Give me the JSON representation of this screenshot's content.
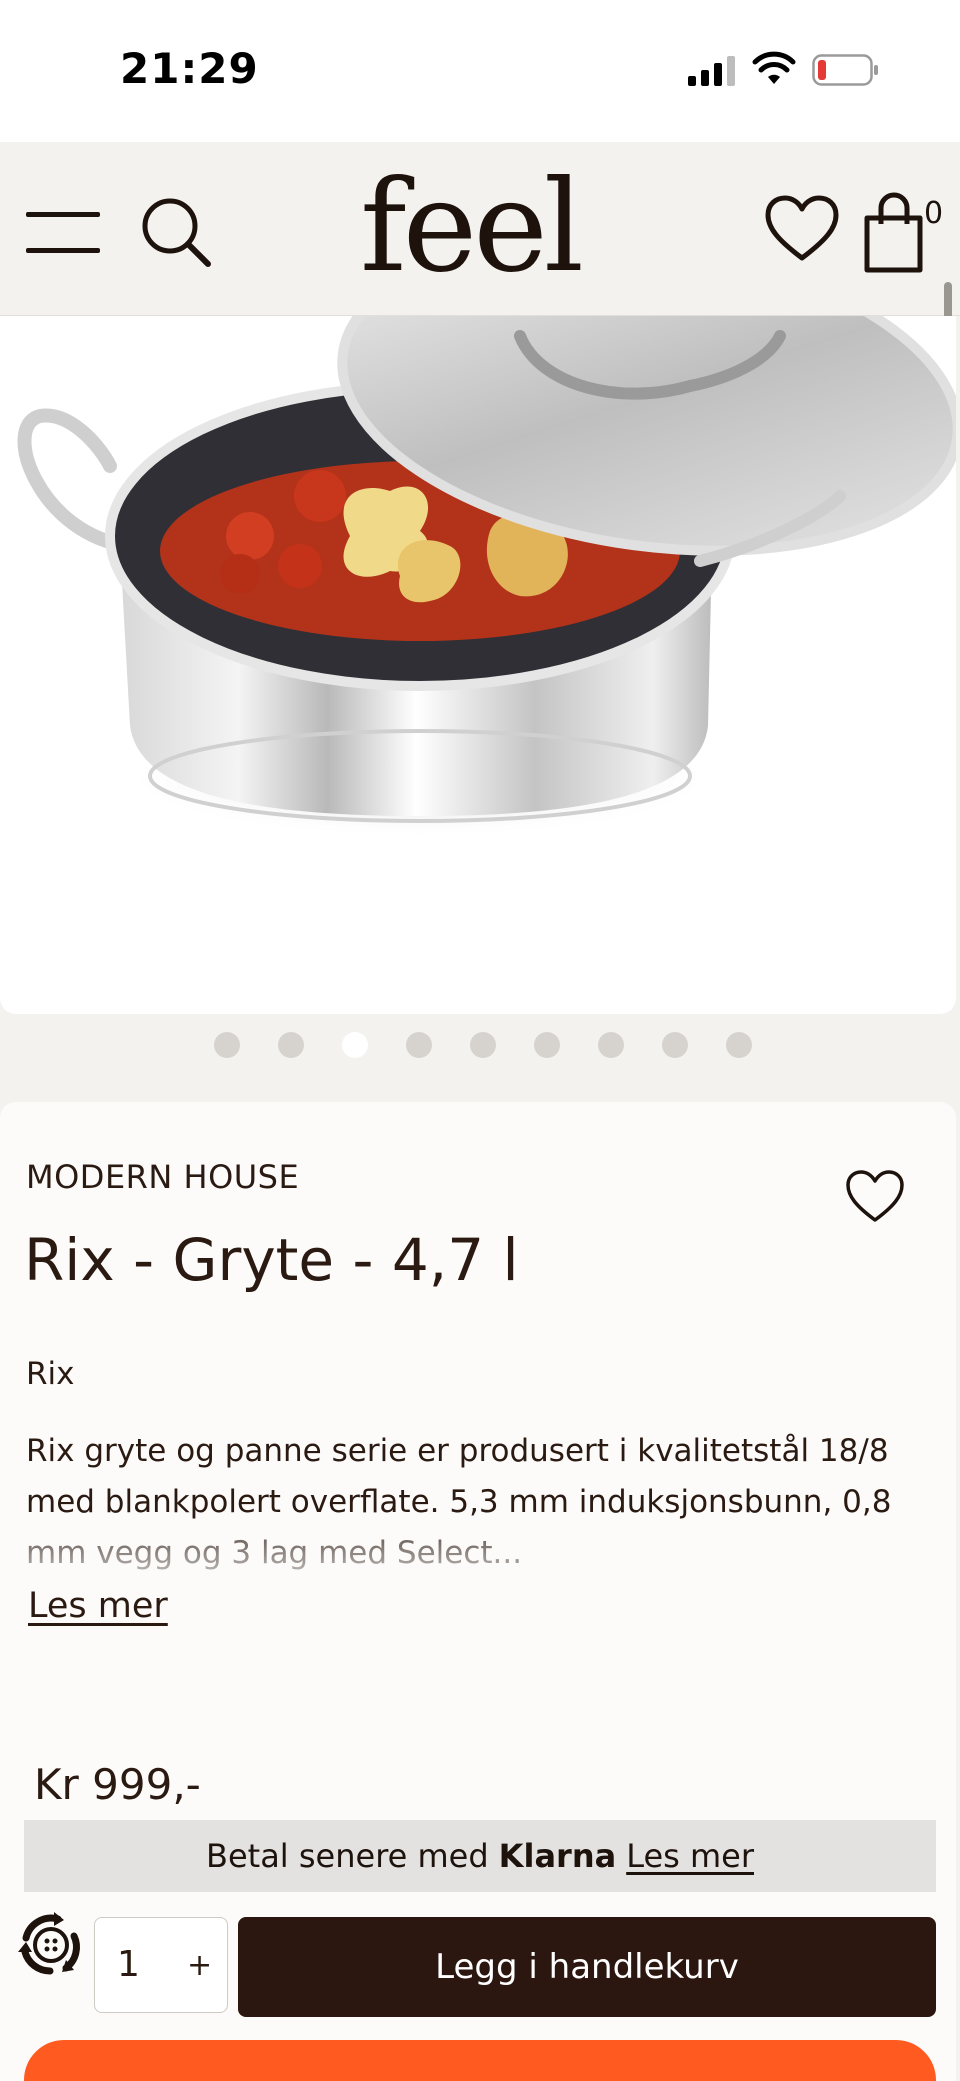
{
  "status_bar": {
    "time": "21:29"
  },
  "header": {
    "logo": "feel",
    "cart_count": "0"
  },
  "gallery": {
    "dot_count": 9,
    "active_index": 2
  },
  "product": {
    "brand": "MODERN HOUSE",
    "title": "Rix - Gryte - 4,7 l",
    "subtitle": "Rix",
    "description": "Rix gryte og panne serie er produsert i kvalitetstål 18/8 med blankpolert overflate. 5,3 mm induksjonsbunn, 0,8 mm vegg og 3 lag med Select...",
    "read_more": "Les mer",
    "price": "Kr 999,-"
  },
  "klarna": {
    "prefix": "Betal senere med",
    "brand": "Klarna",
    "link": "Les mer"
  },
  "purchase": {
    "quantity": "1",
    "plus": "+",
    "add_to_cart": "Legg i handlekurv"
  },
  "colors": {
    "header_bg": "#f4f2ee",
    "primary_button": "#2b1710",
    "accent_orange": "#ff5a1f",
    "klarna_bg": "#e4e2e0"
  }
}
